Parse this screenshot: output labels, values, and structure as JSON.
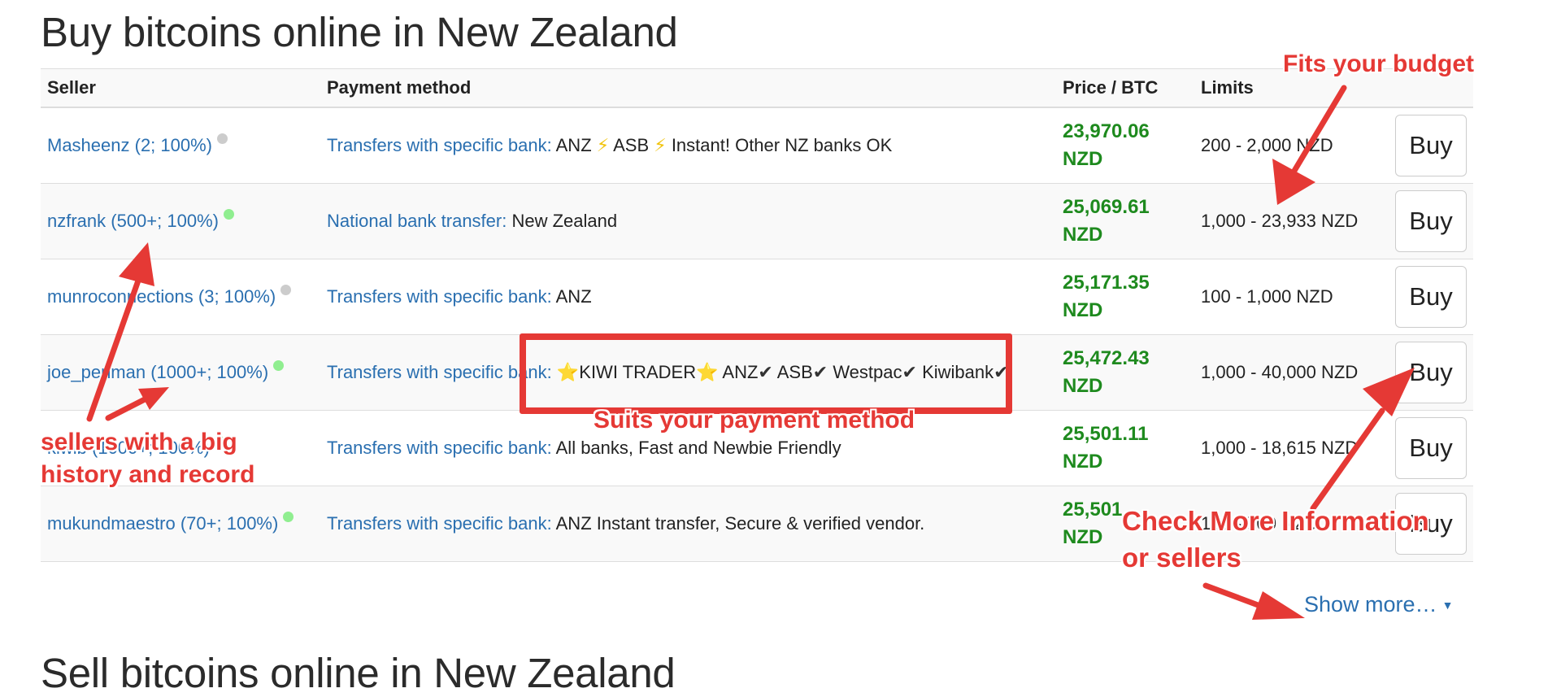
{
  "page": {
    "title": "Buy bitcoins online in New Zealand",
    "next_section_title": "Sell bitcoins online in New Zealand"
  },
  "table": {
    "headers": {
      "seller": "Seller",
      "payment_method": "Payment method",
      "price": "Price / BTC",
      "limits": "Limits"
    },
    "rows": [
      {
        "seller": "Masheenz (2; 100%)",
        "status_color": "#cccccc",
        "method_label": "Transfers with specific bank:",
        "method_parts": [
          {
            "text": " ANZ ",
            "kind": "text"
          },
          {
            "text": "⚡",
            "kind": "bolt"
          },
          {
            "text": " ASB ",
            "kind": "text"
          },
          {
            "text": "⚡",
            "kind": "bolt"
          },
          {
            "text": " Instant! Other NZ banks OK",
            "kind": "text"
          }
        ],
        "price_value": "23,970.06",
        "price_currency": "NZD",
        "limits": "200 - 2,000 NZD",
        "buy_label": "Buy"
      },
      {
        "seller": "nzfrank (500+; 100%)",
        "status_color": "#90ee90",
        "method_label": "National bank transfer:",
        "method_parts": [
          {
            "text": " New Zealand",
            "kind": "text"
          }
        ],
        "price_value": "25,069.61",
        "price_currency": "NZD",
        "limits": "1,000 - 23,933 NZD",
        "buy_label": "Buy"
      },
      {
        "seller": "munroconnections (3; 100%)",
        "status_color": "#cccccc",
        "method_label": "Transfers with specific bank:",
        "method_parts": [
          {
            "text": " ANZ",
            "kind": "text"
          }
        ],
        "price_value": "25,171.35",
        "price_currency": "NZD",
        "limits": "100 - 1,000 NZD",
        "buy_label": "Buy"
      },
      {
        "seller": "joe_penman (1000+; 100%)",
        "status_color": "#90ee90",
        "method_label": "Transfers with specific bank:",
        "method_parts": [
          {
            "text": " ",
            "kind": "text"
          },
          {
            "text": "⭐",
            "kind": "star"
          },
          {
            "text": "KIWI TRADER",
            "kind": "text"
          },
          {
            "text": "⭐",
            "kind": "star"
          },
          {
            "text": " ANZ",
            "kind": "text"
          },
          {
            "text": "✔",
            "kind": "check"
          },
          {
            "text": " ASB",
            "kind": "text"
          },
          {
            "text": "✔",
            "kind": "check"
          },
          {
            "text": " Westpac",
            "kind": "text"
          },
          {
            "text": "✔",
            "kind": "check"
          },
          {
            "text": " Kiwibank",
            "kind": "text"
          },
          {
            "text": "✔",
            "kind": "check"
          }
        ],
        "price_value": "25,472.43",
        "price_currency": "NZD",
        "limits": "1,000 - 40,000 NZD",
        "buy_label": "Buy"
      },
      {
        "seller": "kiwib (1000+; 100%)",
        "status_color": "#90ee90",
        "method_label": "Transfers with specific bank:",
        "method_parts": [
          {
            "text": " All banks, Fast and Newbie Friendly",
            "kind": "text"
          }
        ],
        "price_value": "25,501.11",
        "price_currency": "NZD",
        "limits": "1,000 - 18,615 NZD",
        "buy_label": "Buy"
      },
      {
        "seller": "mukundmaestro (70+; 100%)",
        "status_color": "#90ee90",
        "method_label": "Transfers with specific bank:",
        "method_parts": [
          {
            "text": " ANZ Instant transfer, Secure & verified vendor.",
            "kind": "text"
          }
        ],
        "price_value": "25,501",
        "price_currency": "NZD",
        "limits": "100 - 500 NZD",
        "buy_label": "Buy"
      }
    ]
  },
  "show_more": {
    "label": "Show more…",
    "caret": "▼"
  },
  "annotations": {
    "budget": "Fits your budget",
    "payment": "Suits your payment method",
    "sellers_line1": "sellers with a big",
    "sellers_line2": "history and record",
    "more_line1": "Check More Information",
    "more_line2": "or sellers",
    "color": "#e53935"
  }
}
